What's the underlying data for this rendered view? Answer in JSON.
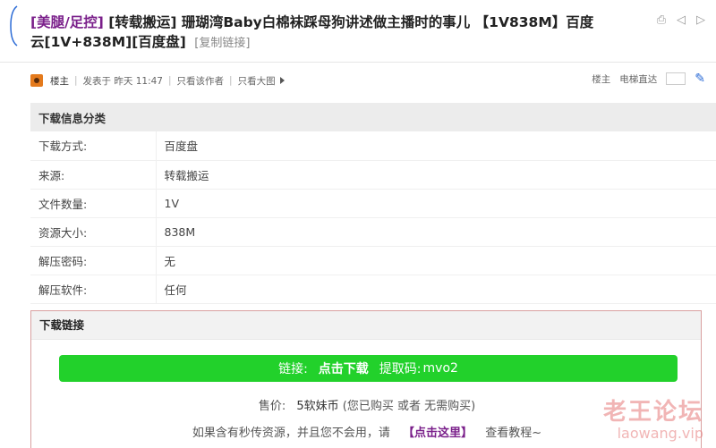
{
  "header": {
    "category": "[美腿/足控]",
    "title": "[转载搬运] 珊瑚湾Baby白棉袜踩母狗讲述做主播时的事儿 【1V838M】百度云[1V+838M][百度盘]",
    "copy_link": "[复制链接]"
  },
  "author_bar": {
    "role": "楼主",
    "posted": "发表于 昨天 11:47",
    "only_author": "只看该作者",
    "big_image": "只看大图",
    "right_role": "楼主",
    "jump_floor": "电梯直达"
  },
  "info": {
    "heading": "下载信息分类",
    "rows": [
      {
        "label": "下载方式:",
        "value": "百度盘"
      },
      {
        "label": "来源:",
        "value": "转载搬运"
      },
      {
        "label": "文件数量:",
        "value": "1V"
      },
      {
        "label": "资源大小:",
        "value": "838M"
      },
      {
        "label": "解压密码:",
        "value": "无"
      },
      {
        "label": "解压软件:",
        "value": "任何"
      }
    ]
  },
  "download": {
    "heading": "下载链接",
    "link_label": "链接:",
    "click_download": "点击下载",
    "code_label": "提取码:",
    "code": "mvo2",
    "price_label": "售价:",
    "price_value": "5软妹币",
    "price_note": "(您已购买 或者 无需购买)",
    "hint_prefix": "如果含有秒传资源，并且您不会用，请",
    "hint_link": "【点击这里】",
    "hint_suffix": "查看教程~"
  },
  "watermark": {
    "cn": "老王论坛",
    "en": "laowang.vip"
  },
  "colors": {
    "accent_purple": "#7a1f8a",
    "download_green": "#22d12b"
  }
}
